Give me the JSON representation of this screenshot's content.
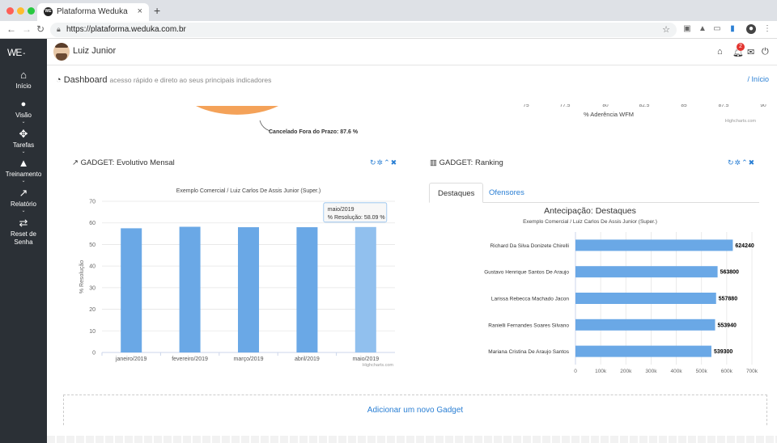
{
  "browser": {
    "tab_title": "Plataforma Weduka",
    "favicon_text": "WE",
    "tab_close": "×",
    "new_tab": "+",
    "url": "https://plataforma.weduka.com.br"
  },
  "app": {
    "logo": "WE",
    "user_name": "Luiz Junior",
    "notification_count": "2",
    "sidebar": [
      {
        "label": "Início",
        "icon": "home-icon",
        "glyph": "⌂"
      },
      {
        "label": "Visão",
        "icon": "user-icon",
        "glyph": "●"
      },
      {
        "label": "Tarefas",
        "icon": "crosshair-icon",
        "glyph": "✥"
      },
      {
        "label": "Treinamento",
        "icon": "graduation-cap-icon",
        "glyph": "▲"
      },
      {
        "label": "Relatório",
        "icon": "line-chart-icon",
        "glyph": "↗"
      },
      {
        "label": "Reset de Senha",
        "icon": "exchange-icon",
        "glyph": "⇄"
      }
    ]
  },
  "dashboard": {
    "title": "Dashboard",
    "subtitle": "acesso rápido e direto ao seus principais indicadores",
    "breadcrumb": "/ Início"
  },
  "top_fragment": {
    "pie_label": "Cancelado Fora do Prazo: 87.6 %",
    "axis_title": "% Aderência WFM",
    "credit": "Highcharts.com",
    "tick_labels": [
      "75",
      "77.5",
      "80",
      "82.5",
      "85",
      "87.5",
      "90"
    ]
  },
  "gadget_evolutivo": {
    "title": "GADGET: Evolutivo Mensal",
    "credit": "Highcharts.com",
    "tooltip": {
      "line1": "maio/2019",
      "line2": "% Resolução: 58.09 %"
    }
  },
  "gadget_ranking": {
    "title": "GADGET: Ranking",
    "tabs": [
      "Destaques",
      "Ofensores"
    ],
    "active_tab": "Destaques"
  },
  "add_gadget": "Adicionar um novo Gadget",
  "chart_data": [
    {
      "type": "bar",
      "title": "Exemplo Comercial / Luiz Carlos De Assis Junior (Super.)",
      "xlabel": "",
      "ylabel": "% Resolução",
      "ylim": [
        0,
        70
      ],
      "yticks": [
        0,
        10,
        20,
        30,
        40,
        50,
        60,
        70
      ],
      "categories": [
        "janeiro/2019",
        "fevereiro/2019",
        "março/2019",
        "abril/2019",
        "maio/2019"
      ],
      "values": [
        57.5,
        58.2,
        58.0,
        58.0,
        58.09
      ],
      "grid": true,
      "colors": {
        "bar": "#6aa8e6",
        "highlight": "#91c0ee"
      }
    },
    {
      "type": "bar",
      "orientation": "horizontal",
      "title": "Antecipação: Destaques",
      "subtitle": "Exemplo Comercial / Luiz Carlos De Assis Junior (Super.)",
      "categories": [
        "Richard Da Silva Donizete Chirelli",
        "Gustavo Henrique Santos De Araujo",
        "Larissa Rebecca Machado Jacon",
        "Ranielli Fernandes Soares Silvano",
        "Mariana Cristina De Araujo Santos"
      ],
      "values": [
        624240,
        563800,
        557880,
        553940,
        539300
      ],
      "data_labels": [
        "624240",
        "563800",
        "557880",
        "553940",
        "539300"
      ],
      "xlim": [
        0,
        700000
      ],
      "xticks": [
        "0",
        "100k",
        "200k",
        "300k",
        "400k",
        "500k",
        "600k",
        "700k"
      ],
      "colors": {
        "bar": "#6aa8e6"
      }
    }
  ]
}
